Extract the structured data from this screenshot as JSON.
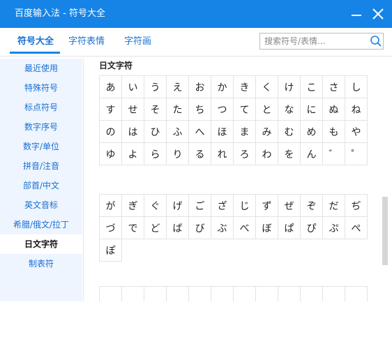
{
  "window": {
    "title": "百度输入法 - 符号大全"
  },
  "tabs": [
    {
      "label": "符号大全"
    },
    {
      "label": "字符表情"
    },
    {
      "label": "字符画"
    }
  ],
  "search": {
    "placeholder": "搜索符号/表情..."
  },
  "sidebar": {
    "items": [
      {
        "label": "最近使用"
      },
      {
        "label": "特殊符号"
      },
      {
        "label": "标点符号"
      },
      {
        "label": "数字序号"
      },
      {
        "label": "数字/单位"
      },
      {
        "label": "拼音/注音"
      },
      {
        "label": "部首/中文"
      },
      {
        "label": "英文音标"
      },
      {
        "label": "希腊/俄文/拉丁"
      },
      {
        "label": "日文字符"
      },
      {
        "label": "制表符"
      }
    ]
  },
  "content": {
    "section_title": "日文字符",
    "group1": [
      "あ",
      "い",
      "う",
      "え",
      "お",
      "か",
      "き",
      "く",
      "け",
      "こ",
      "さ",
      "し",
      "す",
      "せ",
      "そ",
      "た",
      "ち",
      "つ",
      "て",
      "と",
      "な",
      "に",
      "ぬ",
      "ね",
      "の",
      "は",
      "ひ",
      "ふ",
      "へ",
      "ほ",
      "ま",
      "み",
      "む",
      "め",
      "も",
      "や",
      "ゆ",
      "よ",
      "ら",
      "り",
      "る",
      "れ",
      "ろ",
      "わ",
      "を",
      "ん",
      "゛",
      "゜"
    ],
    "group2": [
      "が",
      "ぎ",
      "ぐ",
      "げ",
      "ご",
      "ざ",
      "じ",
      "ず",
      "ぜ",
      "ぞ",
      "だ",
      "ぢ",
      "づ",
      "で",
      "ど",
      "ば",
      "び",
      "ぶ",
      "べ",
      "ぼ",
      "ぱ",
      "ぴ",
      "ぷ",
      "ぺ",
      "ぽ"
    ],
    "group3": [
      "",
      "",
      "",
      "",
      "",
      "",
      "",
      "",
      "",
      "",
      "",
      ""
    ]
  },
  "colors": {
    "accent": "#1684e6",
    "sidebar_bg": "#eef5ff"
  }
}
